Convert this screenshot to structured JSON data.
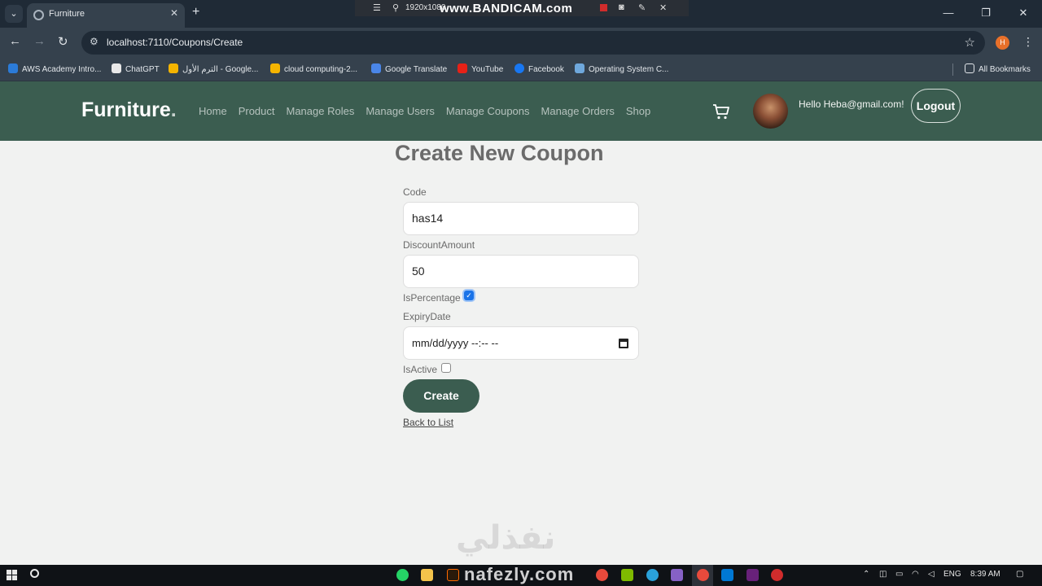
{
  "browser": {
    "tab_title": "Furniture",
    "tab_close": "✕",
    "new_tab": "+",
    "tab_menu": "⌄",
    "url": "localhost:7110/Coupons/Create",
    "profile_initial": "H",
    "window_controls": [
      "—",
      "❐",
      "✕"
    ],
    "bookmarks": [
      {
        "label": "AWS Academy Intro...",
        "icon": "aws-icon",
        "color": "#2b7bd8"
      },
      {
        "label": "ChatGPT",
        "icon": "chatgpt-icon",
        "color": "#e8e8e8"
      },
      {
        "label": "الترم الأول - Google...",
        "icon": "google-drive-icon",
        "color": "#f4b400"
      },
      {
        "label": "cloud computing-2...",
        "icon": "google-drive-icon",
        "color": "#f4b400"
      },
      {
        "label": "Google Translate",
        "icon": "translate-icon",
        "color": "#4a86e8"
      },
      {
        "label": "YouTube",
        "icon": "youtube-icon",
        "color": "#e62117"
      },
      {
        "label": "Facebook",
        "icon": "facebook-icon",
        "color": "#1877f2"
      },
      {
        "label": "Operating System C...",
        "icon": "laptop-icon",
        "color": "#6fa8dc"
      }
    ],
    "all_bookmarks": "All Bookmarks"
  },
  "recorder": {
    "resolution": "1920x1080",
    "brand": "www.BANDICAM.com"
  },
  "site": {
    "brand": "Furniture",
    "brand_dot": ".",
    "nav": [
      "Home",
      "Product",
      "Manage Roles",
      "Manage Users",
      "Manage Coupons",
      "Manage Orders",
      "Shop"
    ],
    "greeting": "Hello Heba@gmail.com!",
    "logout": "Logout"
  },
  "form": {
    "title": "Create New Coupon",
    "code_label": "Code",
    "code_value": "has14",
    "discount_label": "DiscountAmount",
    "discount_value": "50",
    "is_percentage_label": "IsPercentage",
    "is_percentage_checked": true,
    "expiry_label": "ExpiryDate",
    "expiry_value": "mm/dd/yyyy --:-- --",
    "is_active_label": "IsActive",
    "is_active_checked": false,
    "create_button": "Create",
    "back_link": "Back to List"
  },
  "watermark": {
    "arabic": "نفذلي",
    "latin": "nafezly.com"
  },
  "taskbar": {
    "language": "ENG",
    "time": "8:39 AM"
  },
  "colors": {
    "header_green": "#3b5d50",
    "page_bg": "#f1f2f1",
    "checkbox_blue": "#1a73e8"
  }
}
